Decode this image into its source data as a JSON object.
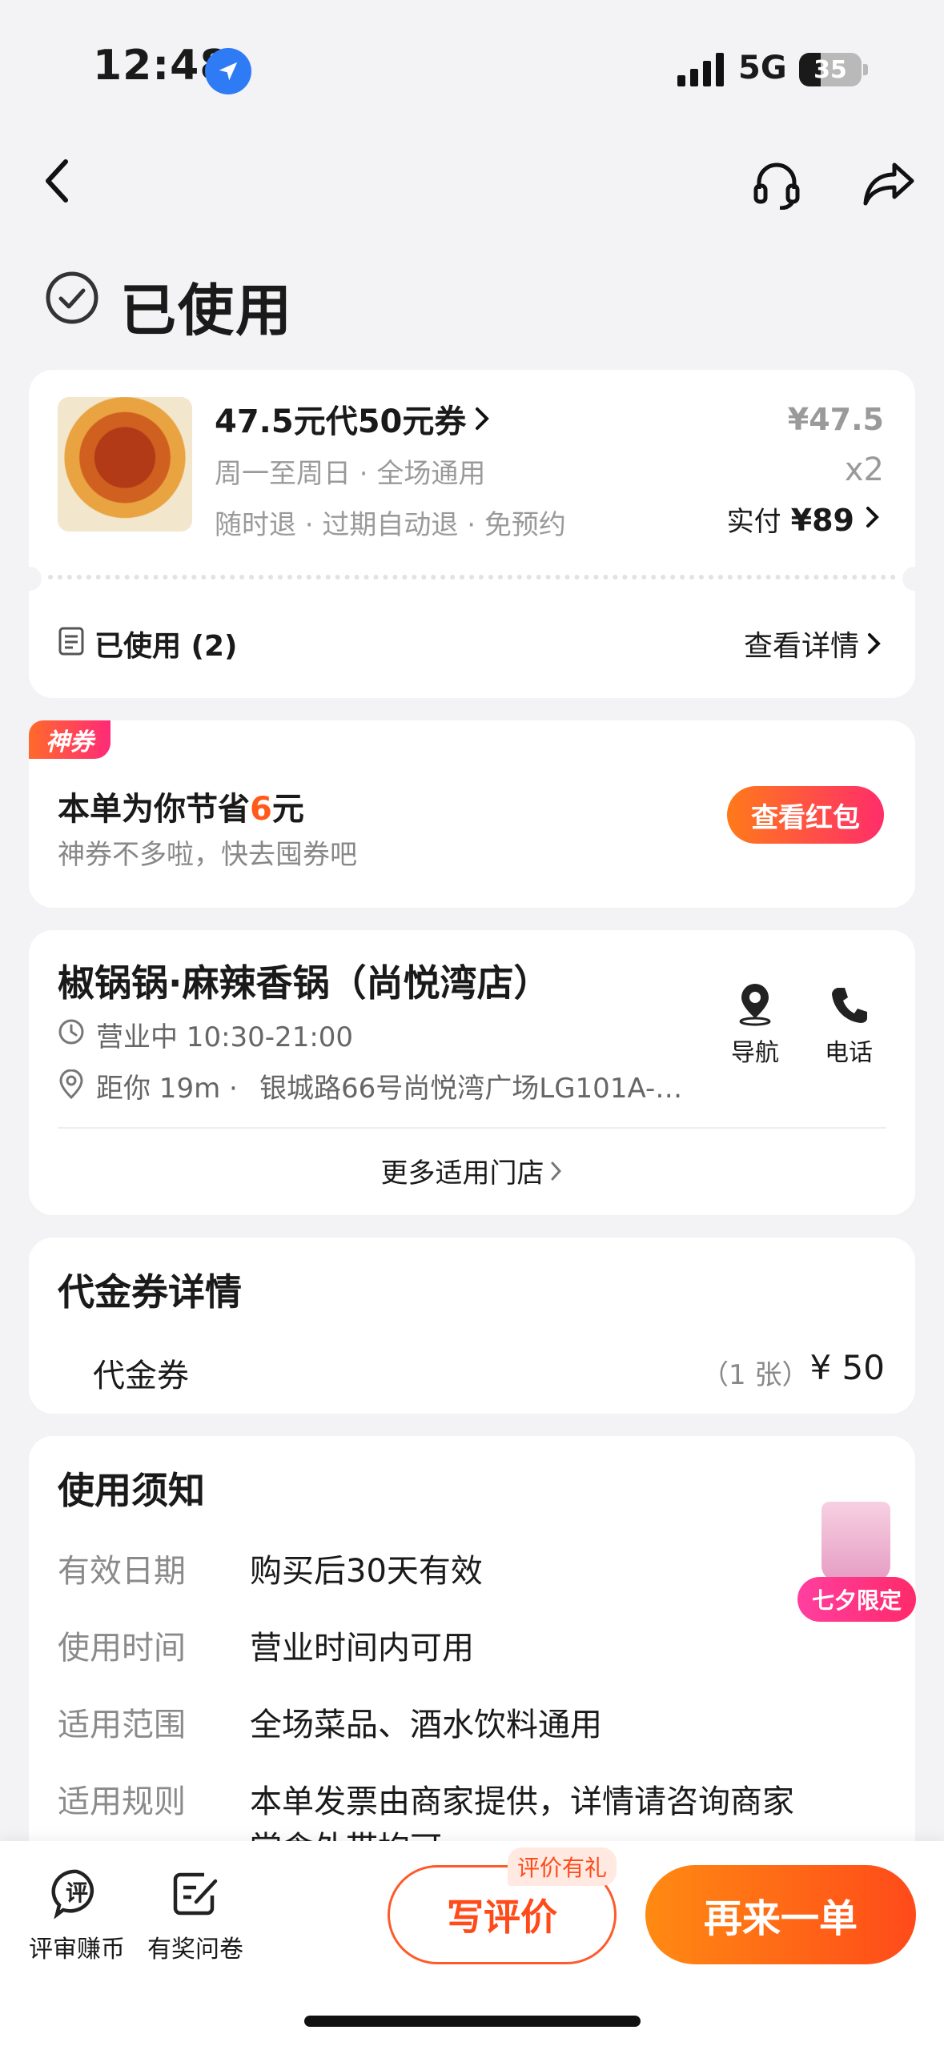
{
  "status_bar": {
    "time": "12:48",
    "network": "5G",
    "battery": "35",
    "battery_level": 0.35
  },
  "header": {
    "status_title": "已使用"
  },
  "order": {
    "coupon_title": "47.5元代50元券",
    "days": "周一至周日 · 全场通用",
    "policies": "随时退 · 过期自动退 · 免预约",
    "unit_price": "¥47.5",
    "quantity": "x2",
    "paid_label": "实付",
    "paid_amount": "¥89",
    "used_label": "已使用 (2)",
    "details_link": "查看详情"
  },
  "savings": {
    "badge": "神券",
    "text_prefix": "本单为你节省",
    "amount": "6",
    "text_suffix": "元",
    "subtext": "神券不多啦，快去囤券吧",
    "button": "查看红包"
  },
  "store": {
    "name": "椒锅锅·麻辣香锅（尚悦湾店）",
    "hours": "营业中 10:30-21:00",
    "distance": "距你 19m ·",
    "address": "银城路66号尚悦湾广场LG101A-…",
    "nav_label": "导航",
    "phone_label": "电话",
    "more_stores": "更多适用门店"
  },
  "voucher_details": {
    "title": "代金券详情",
    "item_name": "代金券",
    "count": "（1 张）",
    "price": "¥ 50"
  },
  "notice": {
    "title": "使用须知",
    "rows": [
      {
        "label": "有效日期",
        "value": "购买后30天有效"
      },
      {
        "label": "使用时间",
        "value": "营业时间内可用"
      },
      {
        "label": "适用范围",
        "value": "全场菜品、酒水饮料通用"
      },
      {
        "label": "适用规则",
        "value": "本单发票由商家提供，详情请咨询商家"
      }
    ],
    "overflow_line": "堂食外带均可",
    "promo_label": "七夕限定"
  },
  "bottom_bar": {
    "review_earn": "评审赚币",
    "survey": "有奖问卷",
    "review_tag": "评价有礼",
    "write_review": "写评价",
    "order_again": "再来一单"
  },
  "colors": {
    "accent": "#ff4a1a",
    "savings_number": "#ff5a1a"
  }
}
